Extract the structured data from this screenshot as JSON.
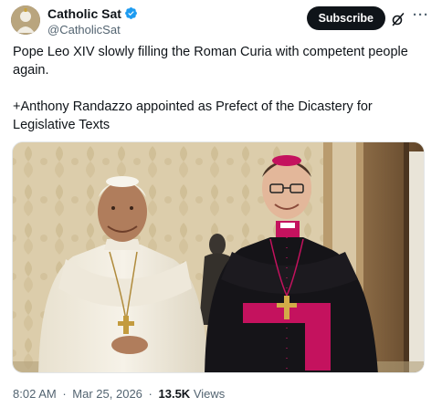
{
  "header": {
    "display_name": "Catholic Sat",
    "handle": "@CatholicSat",
    "subscribe_label": "Subscribe",
    "more_label": "···"
  },
  "post": {
    "paragraphs": [
      "Pope Leo XIV slowly filling the Roman Curia with competent people again.",
      "+Anthony Randazzo appointed as Prefect of the Dicastery for Legislative Texts"
    ]
  },
  "meta": {
    "time": "8:02 AM",
    "separator": "·",
    "date": "Mar 25, 2026",
    "views_count": "13.5K",
    "views_label": "Views"
  },
  "colors": {
    "verified": "#1d9bf0",
    "text_primary": "#0f1419",
    "text_secondary": "#536471",
    "subscribe_bg": "#0f1419",
    "cassock_black": "#151418",
    "fascia_magenta": "#c4125e",
    "papal_white": "#f3eee2"
  }
}
